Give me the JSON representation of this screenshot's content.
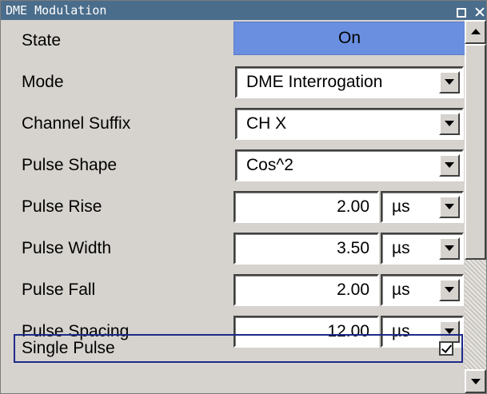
{
  "window": {
    "title": "DME Modulation",
    "controls": [
      "restore-icon",
      "close-icon"
    ]
  },
  "rows": {
    "state": {
      "label": "State",
      "value": "On"
    },
    "mode": {
      "label": "Mode",
      "value": "DME Interrogation"
    },
    "channel_suffix": {
      "label": "Channel Suffix",
      "value": "CH X"
    },
    "pulse_shape": {
      "label": "Pulse Shape",
      "value": "Cos^2"
    },
    "pulse_rise": {
      "label": "Pulse Rise",
      "value": "2.00",
      "unit": "µs"
    },
    "pulse_width": {
      "label": "Pulse Width",
      "value": "3.50",
      "unit": "µs"
    },
    "pulse_fall": {
      "label": "Pulse Fall",
      "value": "2.00",
      "unit": "µs"
    },
    "pulse_spacing": {
      "label": "Pulse Spacing",
      "value": "12.00",
      "unit": "µs"
    },
    "single_pulse": {
      "label": "Single Pulse",
      "checked": true
    }
  },
  "scrollbar": {
    "position_fraction": 0.0,
    "visible_fraction": 0.66
  },
  "colors": {
    "titlebar": "#4a6d8c",
    "state_on": "#6a8fe0",
    "panel": "#d6d3ce",
    "focus_border": "#1e2a8a"
  }
}
